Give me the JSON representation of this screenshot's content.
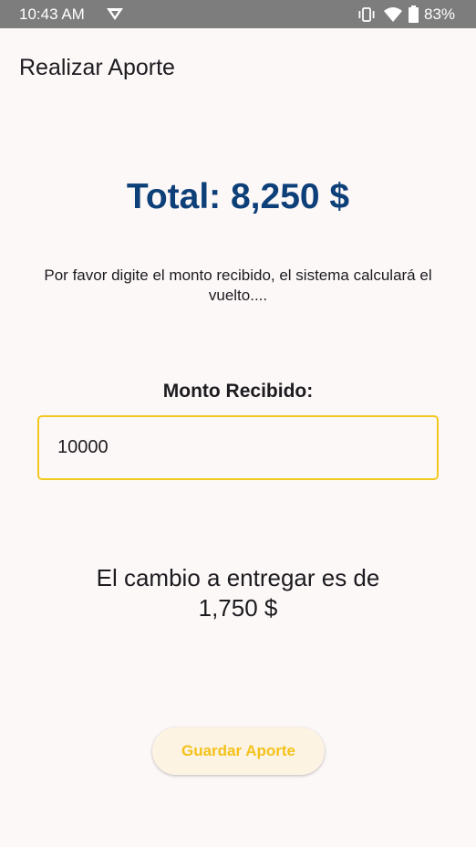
{
  "status_bar": {
    "time": "10:43 AM",
    "battery": "83%",
    "icons": [
      "data-saver-icon",
      "vibrate-icon",
      "wifi-icon",
      "battery-icon"
    ]
  },
  "app": {
    "title": "Realizar Aporte"
  },
  "main": {
    "total": "Total: 8,250 $",
    "instructions": "Por favor digite el monto recibido, el sistema calculará el vuelto....",
    "amount_label": "Monto Recibido:",
    "amount_value": "10000",
    "change_line1": "El cambio a entregar es de",
    "change_line2": "1,750 $",
    "save_label": "Guardar Aporte"
  },
  "colors": {
    "accent": "#f2c81f",
    "total_text": "#0d3f78",
    "background": "#fdf8f8",
    "status_bar": "#7d7d7d"
  }
}
